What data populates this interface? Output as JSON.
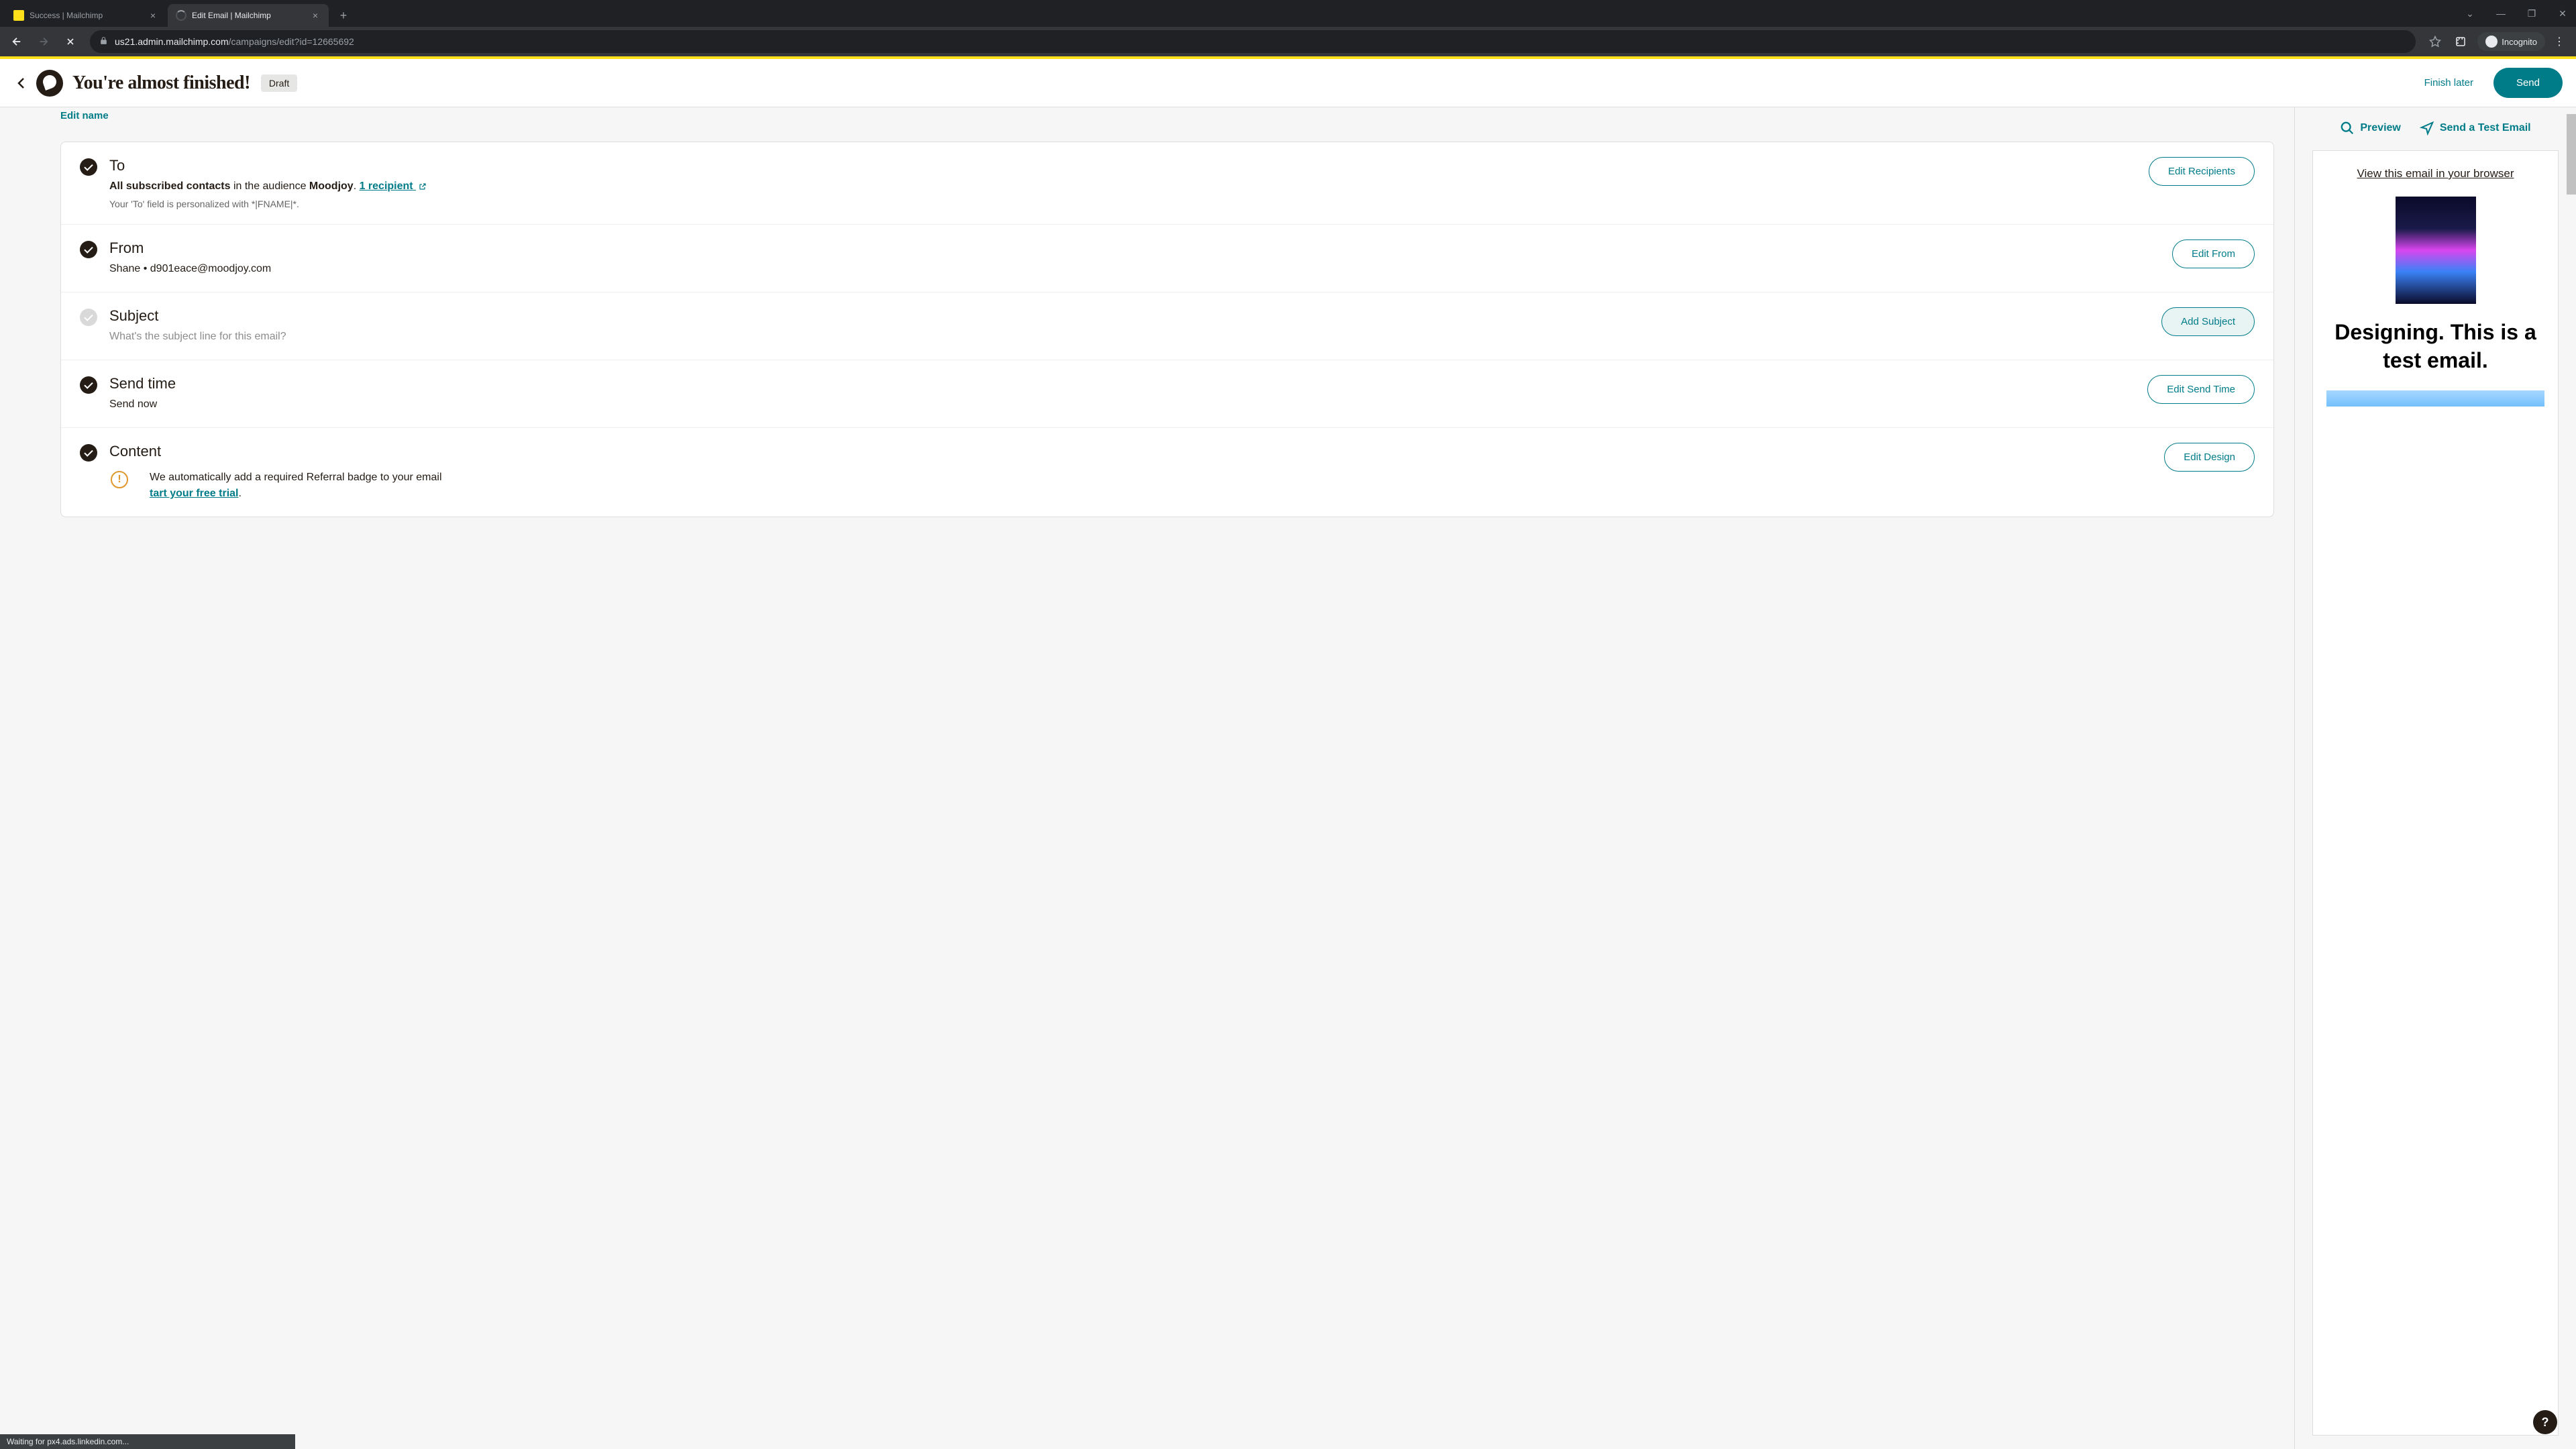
{
  "browser": {
    "tabs": [
      {
        "title": "Success | Mailchimp",
        "active": false
      },
      {
        "title": "Edit Email | Mailchimp",
        "active": true
      }
    ],
    "url_host": "us21.admin.mailchimp.com",
    "url_path": "/campaigns/edit?id=12665692",
    "incognito_label": "Incognito",
    "status_text": "Waiting for px4.ads.linkedin.com..."
  },
  "header": {
    "title": "You're almost finished!",
    "badge": "Draft",
    "finish_later": "Finish later",
    "send": "Send"
  },
  "edit_name": "Edit name",
  "sections": {
    "to": {
      "title": "To",
      "bold1": "All subscribed contacts",
      "mid": " in the audience ",
      "bold2": "Moodjoy",
      "dot": ".  ",
      "link": "1 recipient",
      "helper": "Your 'To' field is personalized with *|FNAME|*.",
      "button": "Edit Recipients"
    },
    "from": {
      "title": "From",
      "name": "Shane",
      "sep": "  •  ",
      "email": "d901eace@moodjoy.com",
      "button": "Edit From"
    },
    "subject": {
      "title": "Subject",
      "placeholder": "What's the subject line for this email?",
      "button": "Add Subject"
    },
    "sendtime": {
      "title": "Send time",
      "value": "Send now",
      "button": "Edit Send Time"
    },
    "content": {
      "title": "Content",
      "button": "Edit Design",
      "note": "We automatically add a required Referral badge to your email",
      "trial_prefix": "",
      "trial_link": "tart your free trial",
      "trial_suffix": "."
    }
  },
  "right": {
    "preview": "Preview",
    "send_test": "Send a Test Email",
    "view_browser": "View this email in your browser",
    "heading": "Designing. This is a test email."
  },
  "help": "?"
}
